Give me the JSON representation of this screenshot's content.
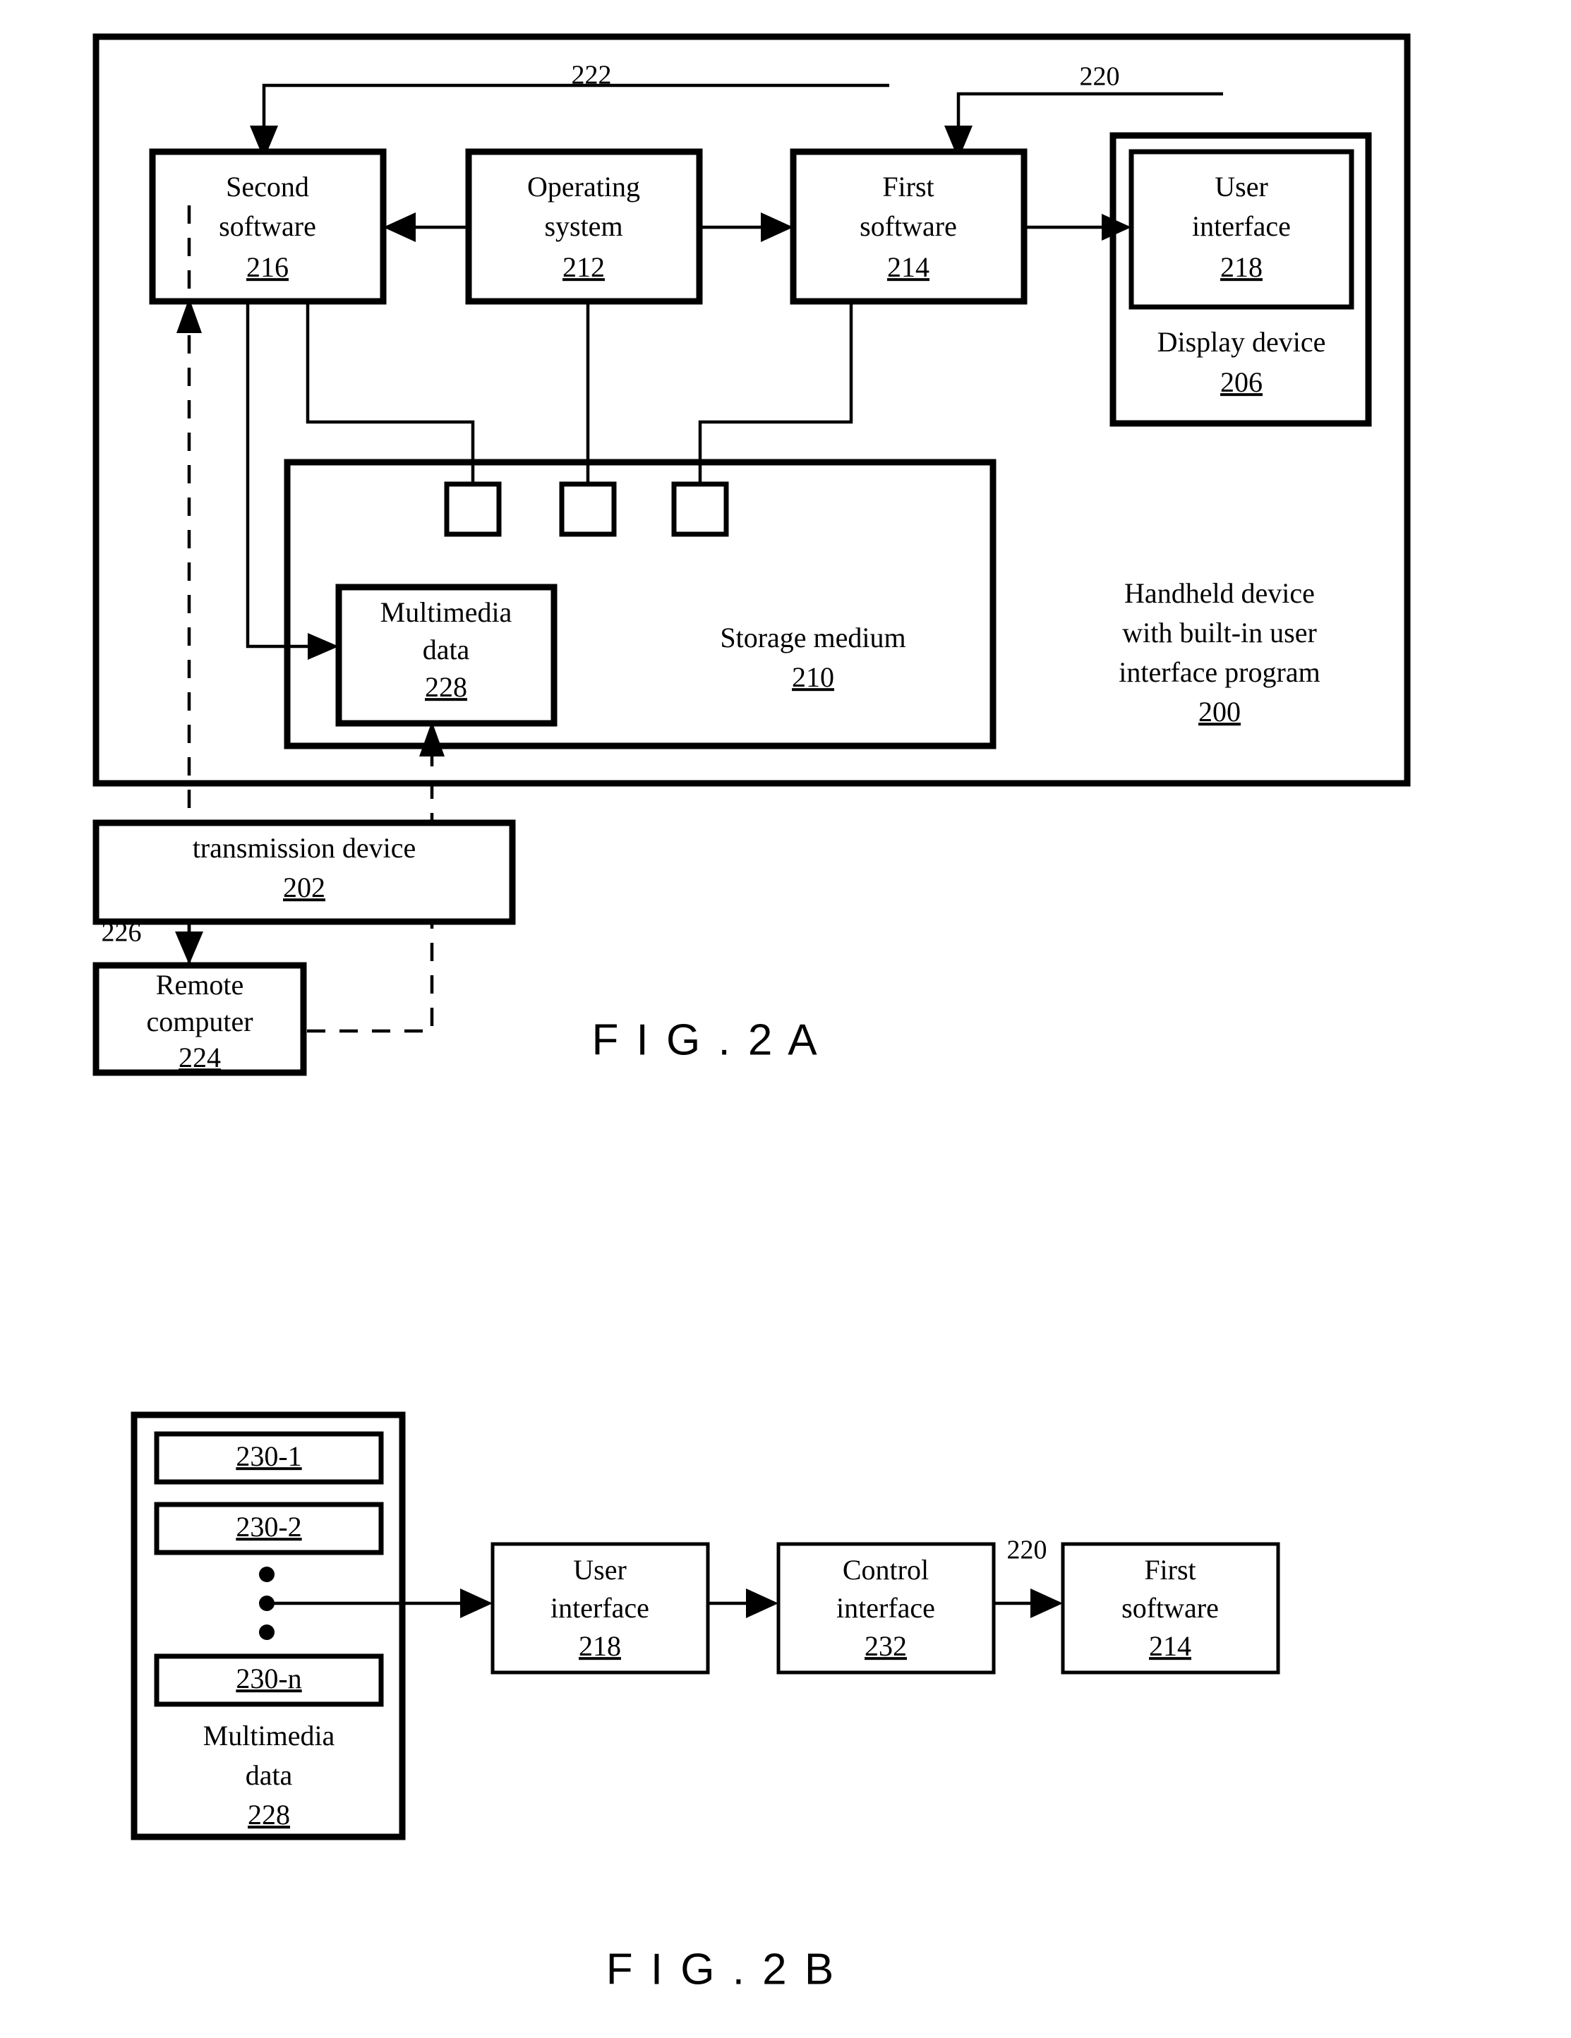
{
  "figures": [
    {
      "caption": "F I G . 2 A",
      "outer_block": {
        "name": "Handheld device with built-in user interface program",
        "line1": "Handheld device",
        "line2": "with built-in user",
        "line3": "interface program",
        "ref": "200"
      },
      "boxes": {
        "second_software": {
          "line1": "Second",
          "line2": "software",
          "ref": "216"
        },
        "operating_system": {
          "line1": "Operating",
          "line2": "system",
          "ref": "212"
        },
        "first_software": {
          "line1": "First",
          "line2": "software",
          "ref": "214"
        },
        "user_interface": {
          "line1": "User",
          "line2": "interface",
          "ref": "218"
        },
        "display_device": {
          "line1": "Display device",
          "ref": "206"
        },
        "storage_medium": {
          "line1": "Storage medium",
          "ref": "210"
        },
        "multimedia_data": {
          "line1": "Multimedia",
          "line2": "data",
          "ref": "228"
        },
        "transmission_device": {
          "line1": "transmission device",
          "ref": "202"
        },
        "remote_computer": {
          "line1": "Remote",
          "line2": "computer",
          "ref": "224"
        }
      },
      "connector_labels": {
        "c222": "222",
        "c220": "220",
        "c226": "226"
      }
    },
    {
      "caption": "F I G . 2 B",
      "boxes": {
        "multimedia_data": {
          "line1": "Multimedia",
          "line2": "data",
          "ref": "228"
        },
        "item_1": {
          "ref": "230-1"
        },
        "item_2": {
          "ref": "230-2"
        },
        "item_n": {
          "ref": "230-n"
        },
        "user_interface": {
          "line1": "User",
          "line2": "interface",
          "ref": "218"
        },
        "control_interface": {
          "line1": "Control",
          "line2": "interface",
          "ref": "232"
        },
        "first_software": {
          "line1": "First",
          "line2": "software",
          "ref": "214"
        }
      },
      "connector_labels": {
        "c220": "220"
      }
    }
  ]
}
